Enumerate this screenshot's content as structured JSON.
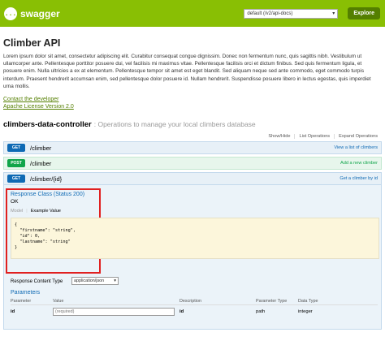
{
  "header": {
    "logo_glyph": "{...}",
    "logo_text": "swagger",
    "spec_select_value": "default (/v2/api-docs)",
    "explore_label": "Explore",
    "brand_color": "#89bf04"
  },
  "api": {
    "title": "Climber API",
    "description": "Lorem ipsum dolor sit amet, consectetur adipiscing elit. Curabitur consequat congue dignissim. Donec non fermentum nunc, quis sagittis nibh. Vestibulum ut ullamcorper ante. Pellentesque porttitor posuere dui, vel facilisis mi maximus vitae. Pellentesque facilisis orci et dictum finibus. Sed quis fermentum ligula, et posuere enim. Nulla ultricies a ex at elementum. Pellentesque tempor sit amet est eget blandit. Sed aliquam neque sed ante commodo, eget commodo turpis interdum. Praesent hendrerit accumsan enim, sed pellentesque dolor posuere id. Nullam hendrerit. Suspendisse posuere libero in lectus egestas, quis imperdiet urna mollis.",
    "contact_link": "Contact the developer",
    "license_link": "Apache License Version 2.0"
  },
  "controller": {
    "name": "climbers-data-controller",
    "description": ": Operations to manage your local climbers database",
    "show_hide": "Show/Hide",
    "list_ops": "List Operations",
    "expand_ops": "Expand Operations"
  },
  "operations": [
    {
      "method": "GET",
      "path": "/climber",
      "summary": "View a list of climbers"
    },
    {
      "method": "POST",
      "path": "/climber",
      "summary": "Add a new climber"
    },
    {
      "method": "GET",
      "path": "/climber/{id}",
      "summary": "Get a climber by id"
    }
  ],
  "expanded": {
    "response_class_title": "Response Class (Status 200)",
    "response_ok": "OK",
    "tab_model": "Model",
    "tab_example": "Example Value",
    "example_json": "{\n  \"firstname\": \"string\",\n  \"id\": 0,\n  \"lastname\": \"string\"\n}",
    "response_content_type_label": "Response Content Type",
    "response_content_type_value": "application/json",
    "parameters_title": "Parameters",
    "param_headers": [
      "Parameter",
      "Value",
      "Description",
      "Parameter Type",
      "Data Type"
    ],
    "param_row": {
      "name": "id",
      "placeholder": "(required)",
      "description": "id",
      "type": "path",
      "data_type": "integer"
    }
  }
}
